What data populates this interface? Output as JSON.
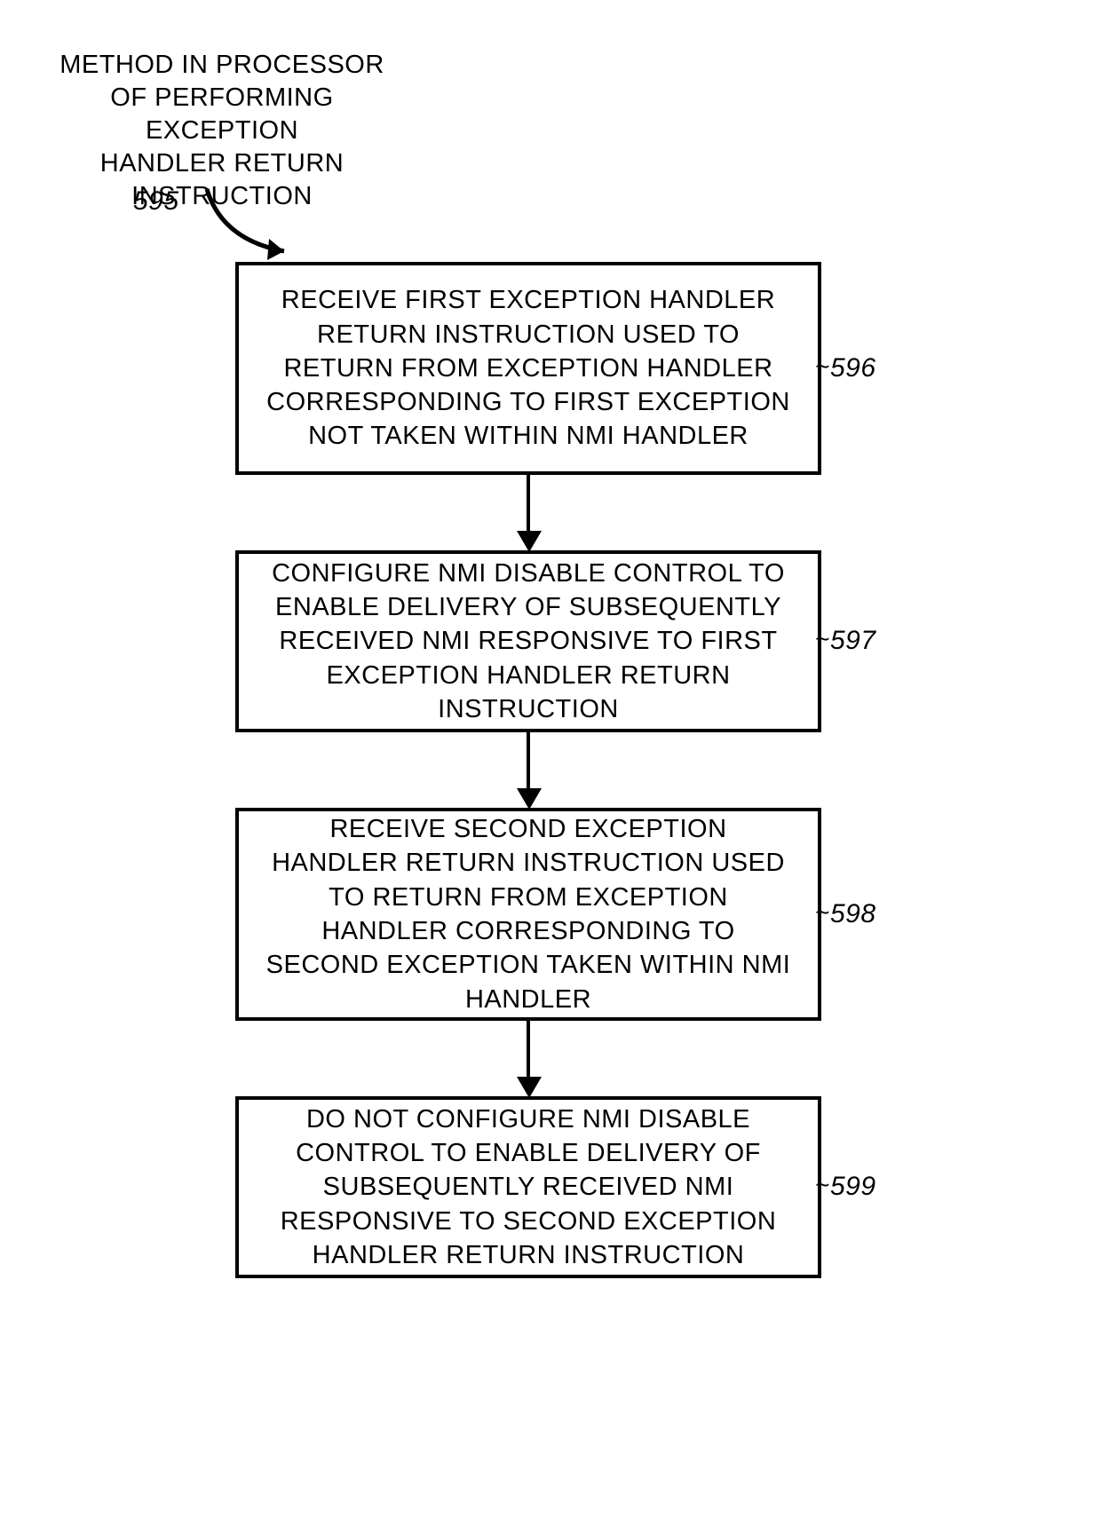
{
  "title": {
    "line1": "METHOD IN PROCESSOR",
    "line2": "OF PERFORMING EXCEPTION",
    "line3": "HANDLER RETURN",
    "line4": "INSTRUCTION",
    "ref": "595"
  },
  "boxes": {
    "b1": {
      "text": "RECEIVE FIRST EXCEPTION HANDLER RETURN INSTRUCTION USED TO RETURN FROM EXCEPTION HANDLER CORRESPONDING TO FIRST EXCEPTION NOT TAKEN WITHIN NMI HANDLER",
      "ref": "596"
    },
    "b2": {
      "text": "CONFIGURE NMI DISABLE CONTROL TO ENABLE DELIVERY OF SUBSEQUENTLY RECEIVED NMI RESPONSIVE TO FIRST EXCEPTION HANDLER RETURN INSTRUCTION",
      "ref": "597"
    },
    "b3": {
      "text": "RECEIVE SECOND EXCEPTION HANDLER RETURN INSTRUCTION USED TO RETURN FROM EXCEPTION HANDLER CORRESPONDING TO SECOND EXCEPTION TAKEN WITHIN NMI HANDLER",
      "ref": "598"
    },
    "b4": {
      "text": "DO NOT CONFIGURE NMI DISABLE CONTROL TO ENABLE DELIVERY OF SUBSEQUENTLY RECEIVED NMI RESPONSIVE TO SECOND EXCEPTION HANDLER RETURN INSTRUCTION",
      "ref": "599"
    }
  }
}
